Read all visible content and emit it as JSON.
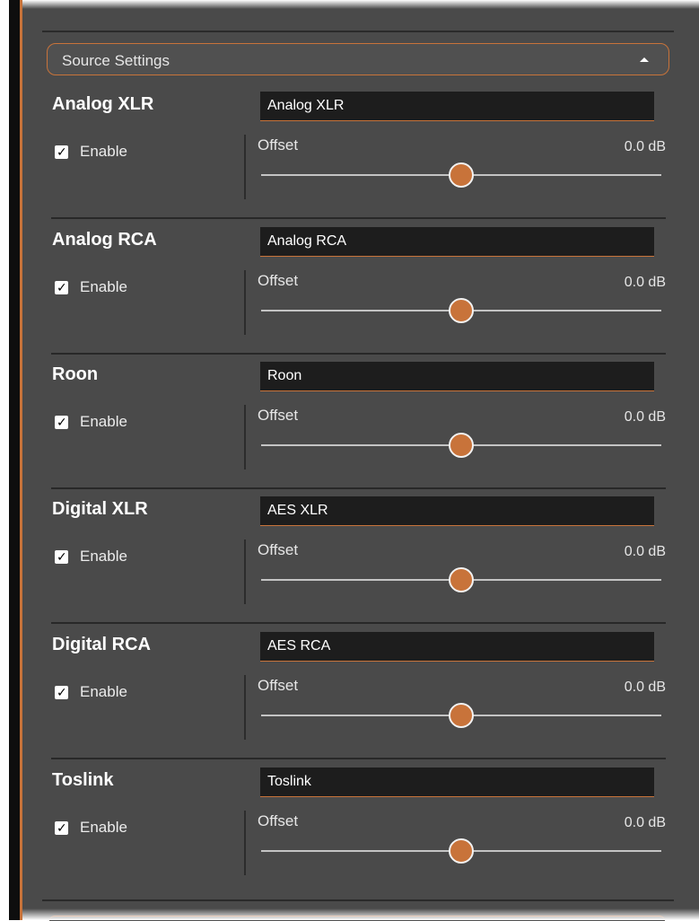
{
  "header": {
    "title": "Source Settings",
    "caret_icon": "caret-up-icon"
  },
  "colors": {
    "accent": "#c8733a",
    "panel": "#4a4a4a",
    "input_bg": "#1d1d1d"
  },
  "sources": [
    {
      "title": "Analog XLR",
      "input_value": "Analog XLR",
      "enable_label": "Enable",
      "enabled": true,
      "offset_label": "Offset",
      "offset_value": "0.0 dB",
      "slider_fraction": 0.5
    },
    {
      "title": "Analog RCA",
      "input_value": "Analog RCA",
      "enable_label": "Enable",
      "enabled": true,
      "offset_label": "Offset",
      "offset_value": "0.0 dB",
      "slider_fraction": 0.5
    },
    {
      "title": "Roon",
      "input_value": "Roon",
      "enable_label": "Enable",
      "enabled": true,
      "offset_label": "Offset",
      "offset_value": "0.0 dB",
      "slider_fraction": 0.5
    },
    {
      "title": "Digital XLR",
      "input_value": "AES XLR",
      "enable_label": "Enable",
      "enabled": true,
      "offset_label": "Offset",
      "offset_value": "0.0 dB",
      "slider_fraction": 0.5
    },
    {
      "title": "Digital RCA",
      "input_value": "AES RCA",
      "enable_label": "Enable",
      "enabled": true,
      "offset_label": "Offset",
      "offset_value": "0.0 dB",
      "slider_fraction": 0.5
    },
    {
      "title": "Toslink",
      "input_value": "Toslink",
      "enable_label": "Enable",
      "enabled": true,
      "offset_label": "Offset",
      "offset_value": "0.0 dB",
      "slider_fraction": 0.5
    }
  ]
}
